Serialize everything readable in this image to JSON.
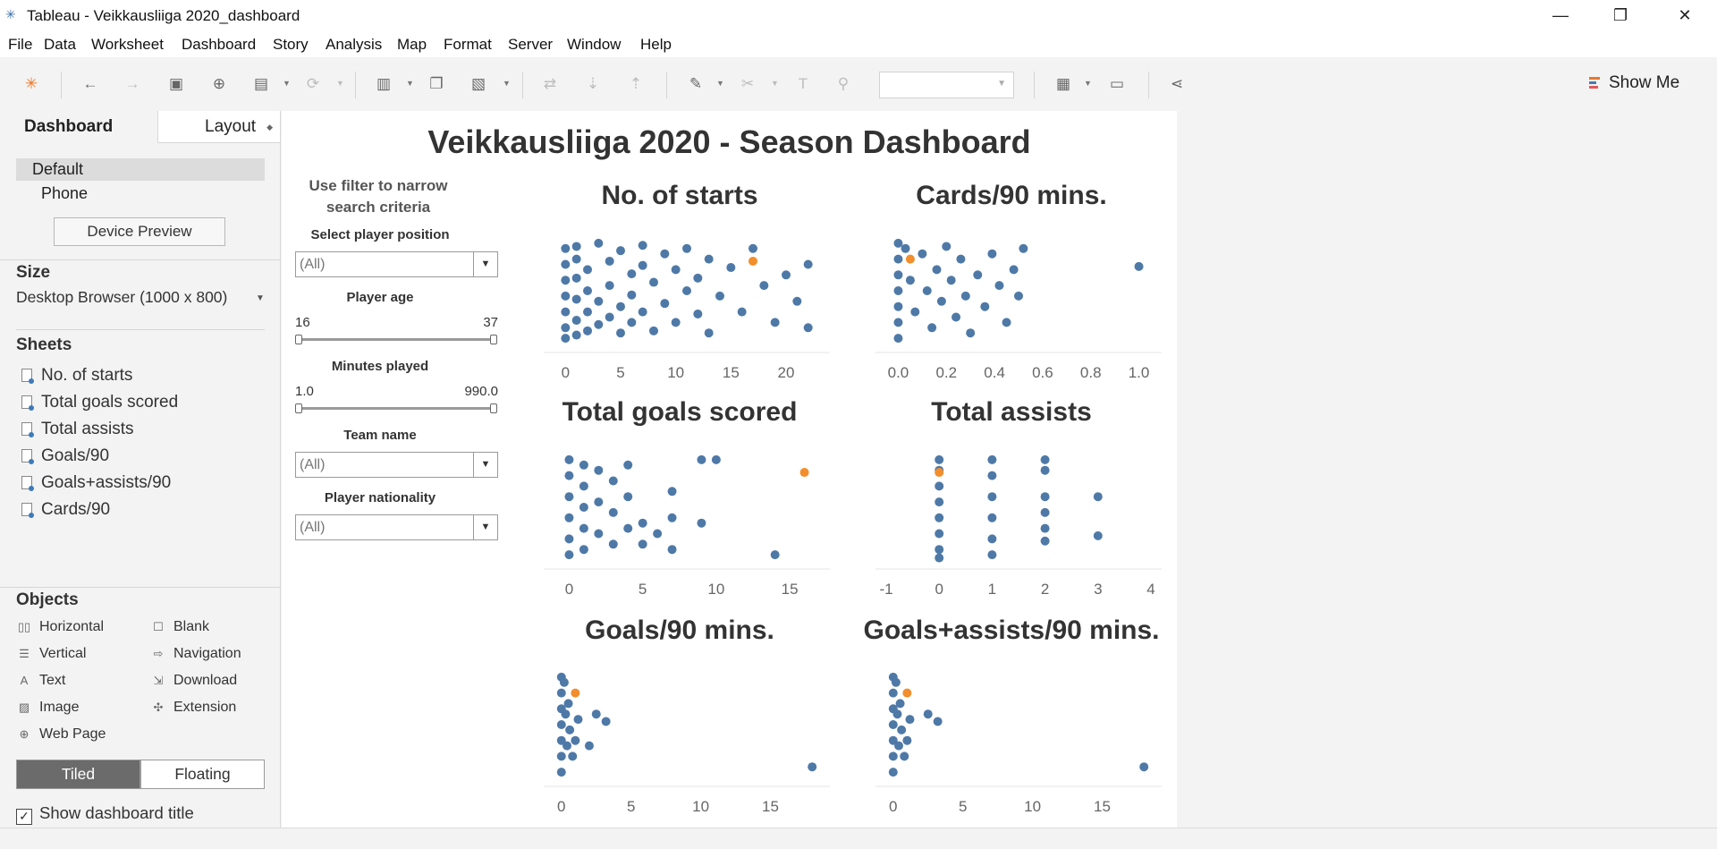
{
  "window": {
    "title": "Tableau - Veikkausliiga 2020_dashboard",
    "minimize": "—",
    "restore": "❐",
    "close": "✕"
  },
  "menu": [
    "File",
    "Data",
    "Worksheet",
    "Dashboard",
    "Story",
    "Analysis",
    "Map",
    "Format",
    "Server",
    "Window",
    "Help"
  ],
  "toolbar": {
    "show_me": "Show Me"
  },
  "left_pane": {
    "tabs": {
      "dashboard": "Dashboard",
      "layout": "Layout"
    },
    "devices": [
      "Default",
      "Phone"
    ],
    "device_preview": "Device Preview",
    "size_header": "Size",
    "size_value": "Desktop Browser (1000 x 800)",
    "sheets_header": "Sheets",
    "sheets": [
      "No. of starts",
      "Total goals scored",
      "Total assists",
      "Goals/90",
      "Goals+assists/90",
      "Cards/90"
    ],
    "objects_header": "Objects",
    "objects": [
      "Horizontal",
      "Blank",
      "Vertical",
      "Navigation",
      "Text",
      "Download",
      "Image",
      "Extension",
      "Web Page"
    ],
    "tiled": "Tiled",
    "floating": "Floating",
    "show_title": "Show dashboard title"
  },
  "dashboard": {
    "title": "Veikkausliiga 2020 - Season Dashboard",
    "filter_note": "Use filter to narrow search criteria",
    "filters": {
      "position_label": "Select player position",
      "position_value": "(All)",
      "age_label": "Player age",
      "age_min": "16",
      "age_max": "37",
      "minutes_label": "Minutes played",
      "minutes_min": "1.0",
      "minutes_max": "990.0",
      "team_label": "Team name",
      "team_value": "(All)",
      "nationality_label": "Player nationality",
      "nationality_value": "(All)"
    }
  },
  "colors": {
    "point": "#4e79a7",
    "highlight": "#f28e2b"
  },
  "chart_data": [
    {
      "type": "scatter",
      "title": "No. of starts",
      "xlim": [
        -1,
        23
      ],
      "xticks": [
        0,
        5,
        10,
        15,
        20
      ],
      "points": [
        [
          0,
          0.9
        ],
        [
          0,
          0.75
        ],
        [
          0,
          0.6
        ],
        [
          0,
          0.45
        ],
        [
          0,
          0.3
        ],
        [
          0,
          0.15
        ],
        [
          0,
          0.05
        ],
        [
          1,
          0.92
        ],
        [
          1,
          0.8
        ],
        [
          1,
          0.62
        ],
        [
          1,
          0.42
        ],
        [
          1,
          0.22
        ],
        [
          1,
          0.08
        ],
        [
          2,
          0.7
        ],
        [
          2,
          0.5
        ],
        [
          2,
          0.3
        ],
        [
          2,
          0.12
        ],
        [
          3,
          0.95
        ],
        [
          3,
          0.4
        ],
        [
          3,
          0.18
        ],
        [
          4,
          0.78
        ],
        [
          4,
          0.55
        ],
        [
          4,
          0.25
        ],
        [
          5,
          0.88
        ],
        [
          5,
          0.35
        ],
        [
          5,
          0.1
        ],
        [
          6,
          0.66
        ],
        [
          6,
          0.46
        ],
        [
          6,
          0.2
        ],
        [
          7,
          0.93
        ],
        [
          7,
          0.74
        ],
        [
          7,
          0.3
        ],
        [
          8,
          0.58
        ],
        [
          8,
          0.12
        ],
        [
          9,
          0.85
        ],
        [
          9,
          0.38
        ],
        [
          10,
          0.7
        ],
        [
          10,
          0.2
        ],
        [
          11,
          0.9
        ],
        [
          11,
          0.5
        ],
        [
          12,
          0.62
        ],
        [
          12,
          0.28
        ],
        [
          13,
          0.8
        ],
        [
          13,
          0.1
        ],
        [
          14,
          0.45
        ],
        [
          15,
          0.72
        ],
        [
          16,
          0.3
        ],
        [
          17,
          0.9
        ],
        [
          18,
          0.55
        ],
        [
          19,
          0.2
        ],
        [
          20,
          0.65
        ],
        [
          21,
          0.4
        ],
        [
          22,
          0.75
        ],
        [
          22,
          0.15
        ]
      ],
      "highlight": [
        [
          17,
          0.78
        ]
      ]
    },
    {
      "type": "scatter",
      "title": "Cards/90 mins.",
      "xlim": [
        -0.05,
        1.05
      ],
      "xticks": [
        "0.0",
        "0.2",
        "0.4",
        "0.6",
        "0.8",
        "1.0"
      ],
      "points": [
        [
          0,
          0.95
        ],
        [
          0,
          0.8
        ],
        [
          0,
          0.65
        ],
        [
          0,
          0.5
        ],
        [
          0,
          0.35
        ],
        [
          0,
          0.2
        ],
        [
          0,
          0.05
        ],
        [
          0.03,
          0.9
        ],
        [
          0.05,
          0.6
        ],
        [
          0.07,
          0.3
        ],
        [
          0.1,
          0.85
        ],
        [
          0.12,
          0.5
        ],
        [
          0.14,
          0.15
        ],
        [
          0.16,
          0.7
        ],
        [
          0.18,
          0.4
        ],
        [
          0.2,
          0.92
        ],
        [
          0.22,
          0.6
        ],
        [
          0.24,
          0.25
        ],
        [
          0.26,
          0.8
        ],
        [
          0.28,
          0.45
        ],
        [
          0.3,
          0.1
        ],
        [
          0.33,
          0.65
        ],
        [
          0.36,
          0.35
        ],
        [
          0.39,
          0.85
        ],
        [
          0.42,
          0.55
        ],
        [
          0.45,
          0.2
        ],
        [
          0.48,
          0.7
        ],
        [
          0.5,
          0.45
        ],
        [
          0.52,
          0.9
        ],
        [
          1.0,
          0.73
        ]
      ],
      "highlight": [
        [
          0.05,
          0.8
        ]
      ]
    },
    {
      "type": "scatter",
      "title": "Total goals scored",
      "xlim": [
        -1,
        17
      ],
      "xticks": [
        0,
        5,
        10,
        15
      ],
      "points": [
        [
          0,
          0.95
        ],
        [
          0,
          0.8
        ],
        [
          0,
          0.6
        ],
        [
          0,
          0.4
        ],
        [
          0,
          0.2
        ],
        [
          0,
          0.05
        ],
        [
          1,
          0.9
        ],
        [
          1,
          0.7
        ],
        [
          1,
          0.5
        ],
        [
          1,
          0.3
        ],
        [
          1,
          0.1
        ],
        [
          2,
          0.85
        ],
        [
          2,
          0.55
        ],
        [
          2,
          0.25
        ],
        [
          3,
          0.75
        ],
        [
          3,
          0.45
        ],
        [
          3,
          0.15
        ],
        [
          4,
          0.9
        ],
        [
          4,
          0.6
        ],
        [
          4,
          0.3
        ],
        [
          5,
          0.35
        ],
        [
          5,
          0.15
        ],
        [
          6,
          0.25
        ],
        [
          7,
          0.65
        ],
        [
          7,
          0.4
        ],
        [
          7,
          0.1
        ],
        [
          9,
          0.95
        ],
        [
          9,
          0.35
        ],
        [
          10,
          0.95
        ],
        [
          14,
          0.05
        ]
      ],
      "highlight": [
        [
          16,
          0.83
        ]
      ]
    },
    {
      "type": "scatter",
      "title": "Total assists",
      "xlim": [
        -1,
        4
      ],
      "xticks": [
        -1,
        0,
        1,
        2,
        3,
        4
      ],
      "points": [
        [
          0,
          0.95
        ],
        [
          0,
          0.85
        ],
        [
          0,
          0.7
        ],
        [
          0,
          0.55
        ],
        [
          0,
          0.4
        ],
        [
          0,
          0.25
        ],
        [
          0,
          0.1
        ],
        [
          0,
          0.02
        ],
        [
          1,
          0.95
        ],
        [
          1,
          0.8
        ],
        [
          1,
          0.6
        ],
        [
          1,
          0.4
        ],
        [
          1,
          0.2
        ],
        [
          1,
          0.05
        ],
        [
          2,
          0.95
        ],
        [
          2,
          0.85
        ],
        [
          2,
          0.6
        ],
        [
          2,
          0.45
        ],
        [
          2,
          0.3
        ],
        [
          2,
          0.18
        ],
        [
          3,
          0.6
        ],
        [
          3,
          0.23
        ]
      ],
      "highlight": [
        [
          0,
          0.83
        ]
      ]
    },
    {
      "type": "scatter",
      "title": "Goals/90 mins.",
      "xlim": [
        -0.5,
        18.5
      ],
      "xticks": [
        0,
        5,
        10,
        15
      ],
      "points": [
        [
          0,
          0.95
        ],
        [
          0,
          0.8
        ],
        [
          0,
          0.65
        ],
        [
          0,
          0.5
        ],
        [
          0,
          0.35
        ],
        [
          0,
          0.2
        ],
        [
          0,
          0.05
        ],
        [
          0.2,
          0.9
        ],
        [
          0.3,
          0.6
        ],
        [
          0.4,
          0.3
        ],
        [
          0.5,
          0.7
        ],
        [
          0.6,
          0.45
        ],
        [
          0.8,
          0.2
        ],
        [
          1,
          0.35
        ],
        [
          1.2,
          0.55
        ],
        [
          2,
          0.3
        ],
        [
          2.5,
          0.6
        ],
        [
          3.2,
          0.53
        ],
        [
          18,
          0.1
        ]
      ],
      "highlight": [
        [
          1,
          0.8
        ]
      ]
    },
    {
      "type": "scatter",
      "title": "Goals+assists/90 mins.",
      "xlim": [
        -0.5,
        18.5
      ],
      "xticks": [
        0,
        5,
        10,
        15
      ],
      "points": [
        [
          0,
          0.95
        ],
        [
          0,
          0.8
        ],
        [
          0,
          0.65
        ],
        [
          0,
          0.5
        ],
        [
          0,
          0.35
        ],
        [
          0,
          0.2
        ],
        [
          0,
          0.05
        ],
        [
          0.2,
          0.9
        ],
        [
          0.3,
          0.6
        ],
        [
          0.4,
          0.3
        ],
        [
          0.5,
          0.7
        ],
        [
          0.6,
          0.45
        ],
        [
          0.8,
          0.2
        ],
        [
          1,
          0.35
        ],
        [
          1.2,
          0.55
        ],
        [
          2.5,
          0.6
        ],
        [
          3.2,
          0.53
        ],
        [
          18,
          0.1
        ]
      ],
      "highlight": [
        [
          1,
          0.8
        ]
      ]
    }
  ]
}
